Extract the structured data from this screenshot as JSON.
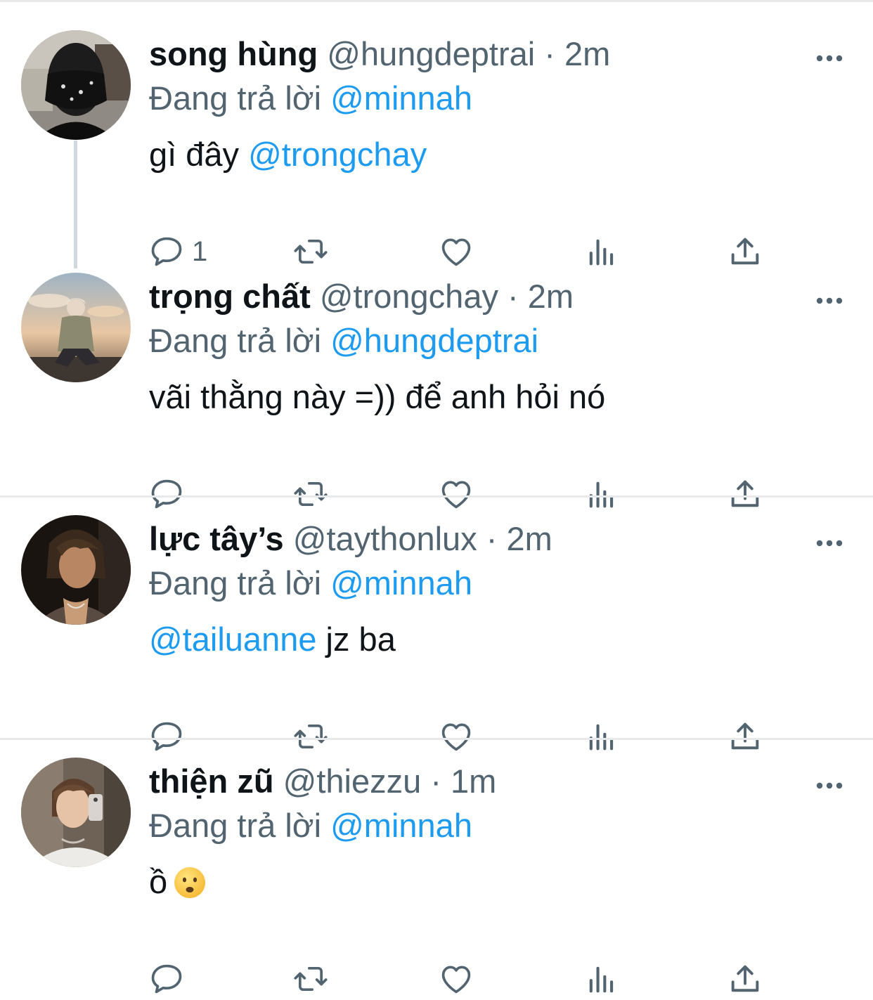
{
  "reply_prefix": "Đang trả lời",
  "tweets": [
    {
      "display_name": "song hùng",
      "handle": "@hungdeptrai",
      "separator": "·",
      "time": "2m",
      "reply_to": "@minnah",
      "body_text": "gì đây ",
      "body_mention": "@trongchay",
      "reply_count": "1"
    },
    {
      "display_name": "trọng chất",
      "handle": "@trongchay",
      "separator": "·",
      "time": "2m",
      "reply_to": "@hungdeptrai",
      "body_text": "vãi thằng này =)) để anh hỏi nó",
      "reply_count": ""
    },
    {
      "display_name": "lực tây’s",
      "handle": "@taythonlux",
      "separator": "·",
      "time": "2m",
      "reply_to": "@minnah",
      "body_mention": "@tailuanne",
      "body_text": " jz ba",
      "reply_count": ""
    },
    {
      "display_name": "thiện zũ",
      "handle": "@thiezzu",
      "separator": "·",
      "time": "1m",
      "reply_to": "@minnah",
      "body_text": "ồ",
      "body_emoji": "frowning-face-emoji",
      "reply_count": ""
    }
  ],
  "colors": {
    "accent": "#1d9bf0",
    "secondary_text": "#536471",
    "primary_text": "#0f1419",
    "divider": "#e7e9ea",
    "thread_line": "#cfd9de"
  },
  "icons": {
    "more": "more-horizontal-icon",
    "reply": "reply-bubble-icon",
    "retweet": "retweet-icon",
    "like": "heart-icon",
    "views": "bar-chart-icon",
    "share": "share-upload-icon"
  }
}
